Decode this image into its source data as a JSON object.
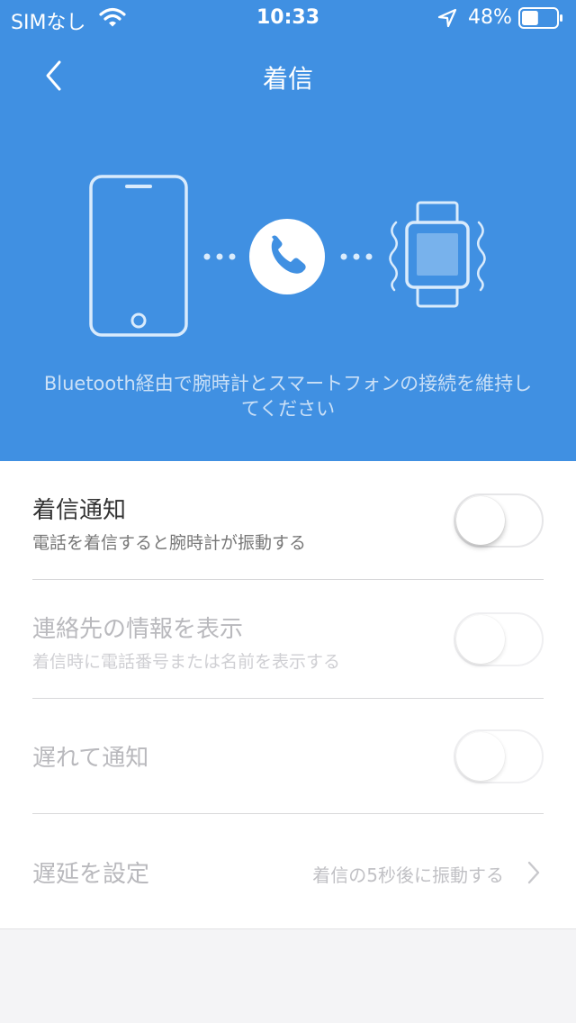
{
  "status_bar": {
    "carrier": "SIMなし",
    "time": "10:33",
    "battery_percent": "48%",
    "battery_level": 0.48,
    "icons": [
      "wifi-icon",
      "location-arrow-icon",
      "battery-icon"
    ]
  },
  "nav": {
    "title": "着信",
    "back_icon": "chevron-left-icon"
  },
  "hero": {
    "description": "Bluetooth経由で腕時計とスマートフォンの接続を維持してください",
    "icons": [
      "phone-device-icon",
      "phone-call-icon",
      "smartwatch-icon"
    ]
  },
  "settings": {
    "incoming_notification": {
      "title": "着信通知",
      "subtitle": "電話を着信すると腕時計が振動する",
      "enabled": false
    },
    "show_contact_info": {
      "title": "連絡先の情報を表示",
      "subtitle": "着信時に電話番号または名前を表示する",
      "enabled": false
    },
    "delayed_notification": {
      "title": "遅れて通知",
      "enabled": false
    },
    "delay_setting": {
      "title": "遅延を設定",
      "value": "着信の5秒後に振動する"
    }
  },
  "colors": {
    "header_blue": "#4090e2",
    "disabled_text": "#b9b9bd"
  }
}
